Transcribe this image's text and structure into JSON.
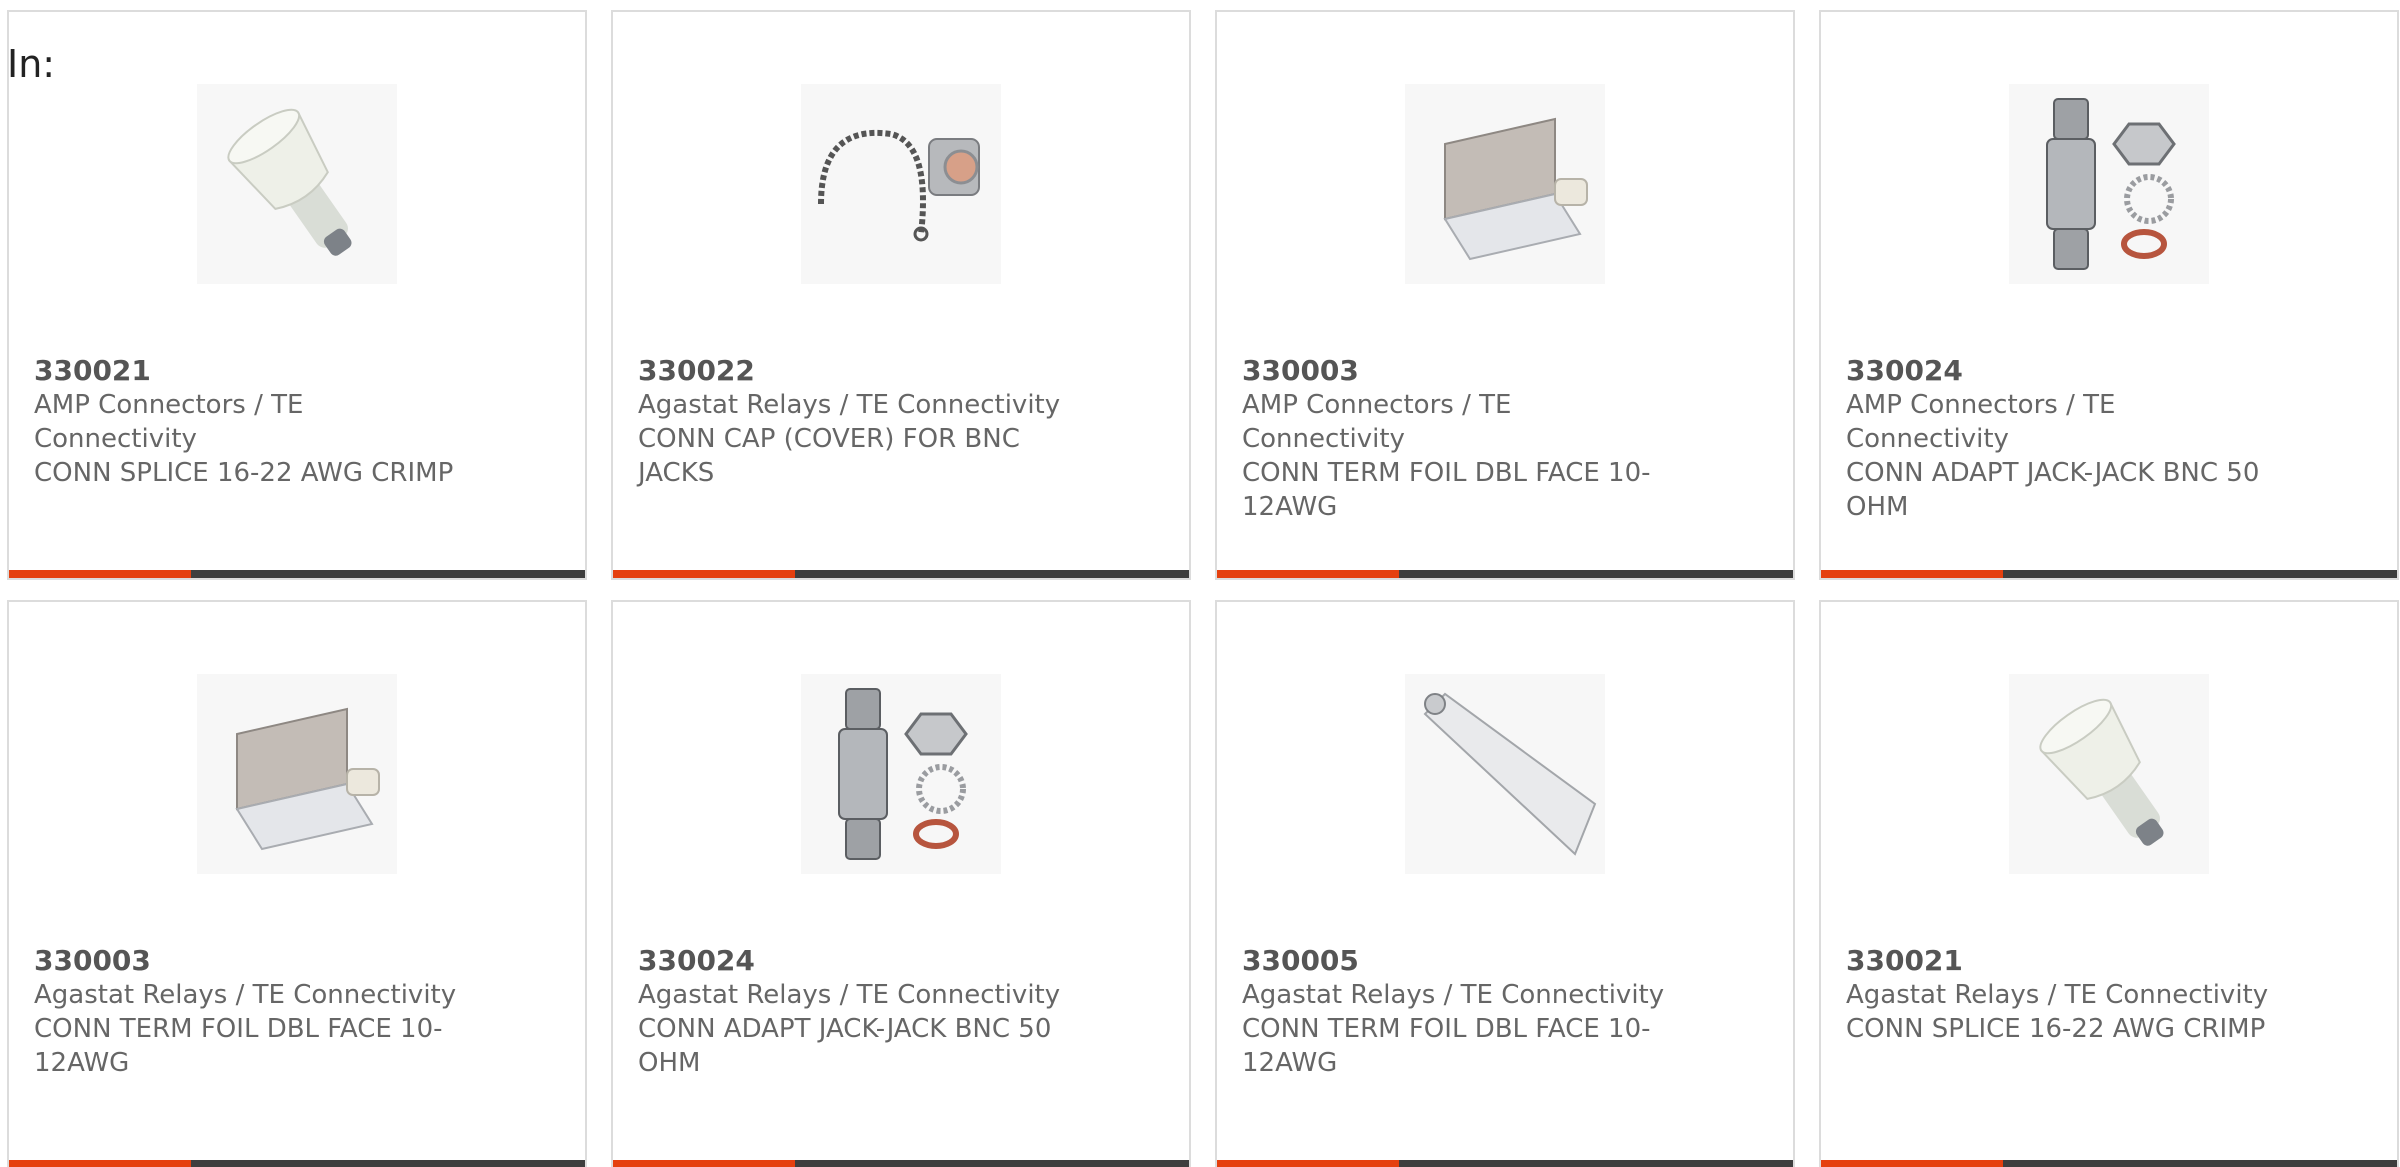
{
  "filter_label": "In:",
  "colors": {
    "accent": "#e5400f",
    "bar": "#3e3e3e",
    "border": "#dcdcdc",
    "text": "#666666"
  },
  "products": [
    {
      "part_number": "330021",
      "brand": "AMP Connectors / TE Connectivity",
      "description": "CONN SPLICE 16-22 AWG CRIMP",
      "image_icon": "splice-connector-icon"
    },
    {
      "part_number": "330022",
      "brand": "Agastat Relays / TE Connectivity",
      "description": "CONN CAP (COVER) FOR BNC JACKS",
      "image_icon": "bnc-cap-chain-icon"
    },
    {
      "part_number": "330003",
      "brand": "AMP Connectors / TE Connectivity",
      "description": "CONN TERM FOIL DBL FACE 10-12AWG",
      "image_icon": "foil-terminal-icon"
    },
    {
      "part_number": "330024",
      "brand": "AMP Connectors / TE Connectivity",
      "description": "CONN ADAPT JACK-JACK BNC 50 OHM",
      "image_icon": "bnc-adapter-icon"
    },
    {
      "part_number": "330003",
      "brand": "Agastat Relays / TE Connectivity",
      "description": "CONN TERM FOIL DBL FACE 10-12AWG",
      "image_icon": "foil-terminal-icon"
    },
    {
      "part_number": "330024",
      "brand": "Agastat Relays / TE Connectivity",
      "description": "CONN ADAPT JACK-JACK BNC 50 OHM",
      "image_icon": "bnc-adapter-icon"
    },
    {
      "part_number": "330005",
      "brand": "Agastat Relays / TE Connectivity",
      "description": "CONN TERM FOIL DBL FACE 10-12AWG",
      "image_icon": "foil-strip-icon"
    },
    {
      "part_number": "330021",
      "brand": "Agastat Relays / TE Connectivity",
      "description": "CONN SPLICE 16-22 AWG CRIMP",
      "image_icon": "splice-connector-icon"
    }
  ]
}
